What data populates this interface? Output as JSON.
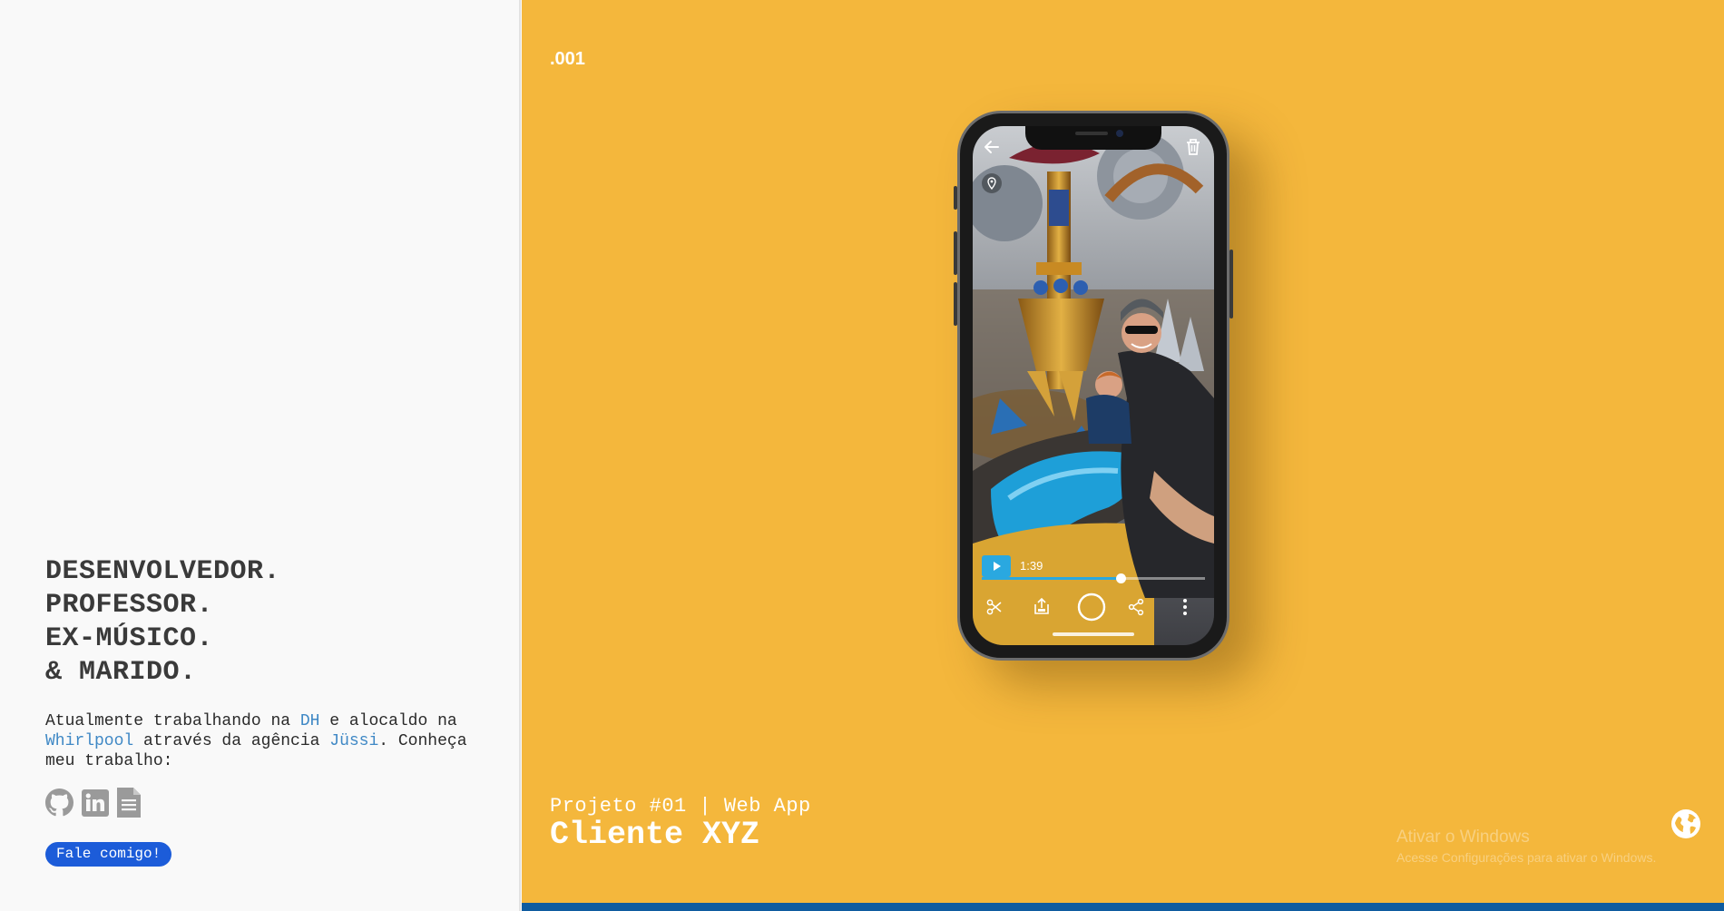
{
  "profile": {
    "headline": [
      "DESENVOLVEDOR.",
      "PROFESSOR.",
      "EX-MÚSICO.",
      "& MARIDO."
    ],
    "intro": {
      "t1": "Atualmente trabalhando na ",
      "link1": "DH",
      "t2": " e alocaldo na ",
      "link2": "Whirlpool",
      "t3": " através da agência ",
      "link3": "Jüssi",
      "t4": ". Conheça meu trabalho:"
    },
    "social": [
      "github-icon",
      "linkedin-icon",
      "resume-document-icon"
    ],
    "cta_label": "Fale comigo!",
    "link_color": "#3f88c5",
    "cta_color": "#1c5cd9"
  },
  "project": {
    "number": ".001",
    "subtitle": "Projeto #01 | Web App",
    "client": "Cliente XYZ",
    "background_color": "#f4b73c",
    "bar_color": "#0f5ca0"
  },
  "phone_ui": {
    "video_time": "1:39",
    "progress": 0.62,
    "accent_color": "#2aa8e0",
    "icons": [
      "back-arrow-icon",
      "trash-icon",
      "location-pin-icon",
      "play-icon",
      "scissors-icon",
      "export-icon",
      "record-circle-icon",
      "share-icon",
      "more-vertical-icon"
    ]
  },
  "windows_watermark": {
    "line1": "Ativar o Windows",
    "line2": "Acesse Configurações para ativar o Windows."
  }
}
